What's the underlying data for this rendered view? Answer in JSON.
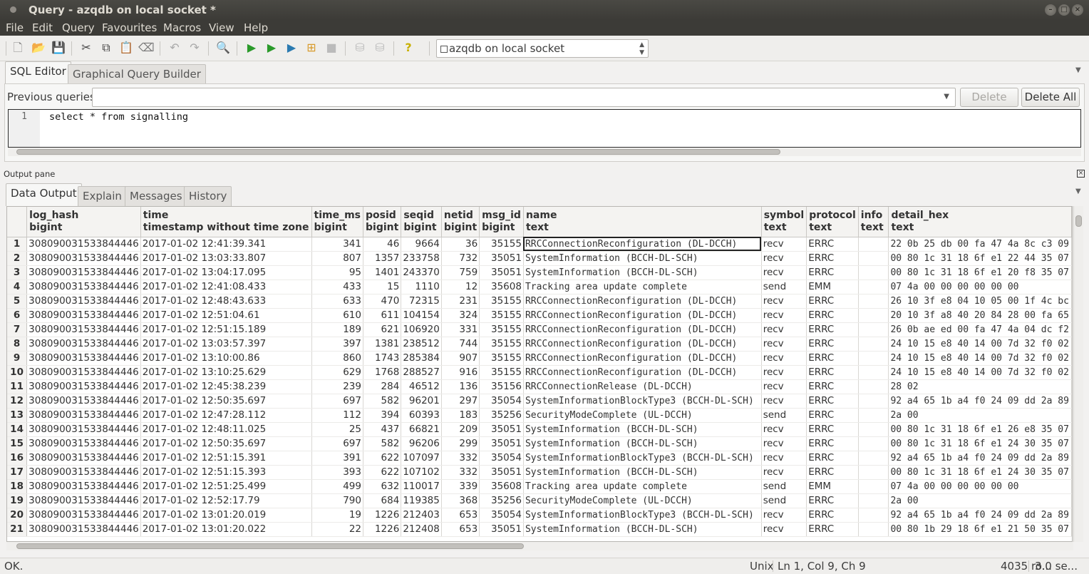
{
  "window": {
    "title": "Query - azqdb on local socket *"
  },
  "menu": [
    "File",
    "Edit",
    "Query",
    "Favourites",
    "Macros",
    "View",
    "Help"
  ],
  "toolbar": {
    "icons": [
      "new-file-icon",
      "open-folder-icon",
      "save-icon",
      "cut-icon",
      "copy-icon",
      "paste-icon",
      "clear-icon",
      "undo-icon",
      "redo-icon",
      "find-icon",
      "execute-icon",
      "execute-explain-icon",
      "execute-to-file-icon",
      "explain-icon",
      "stop-icon",
      "commit-icon",
      "rollback-icon",
      "help-icon"
    ],
    "connection": "azqdb on local socket"
  },
  "editor_tabs": [
    "SQL Editor",
    "Graphical Query Builder"
  ],
  "previous_queries": {
    "label": "Previous queries",
    "delete": "Delete",
    "delete_all": "Delete All"
  },
  "sql": {
    "line_number": "1",
    "text": "select * from signalling"
  },
  "output": {
    "pane_title": "Output pane",
    "tabs": [
      "Data Output",
      "Explain",
      "Messages",
      "History"
    ],
    "columns": [
      {
        "name": "log_hash",
        "type": "bigint"
      },
      {
        "name": "time",
        "type": "timestamp without time zone"
      },
      {
        "name": "time_ms",
        "type": "bigint"
      },
      {
        "name": "posid",
        "type": "bigint"
      },
      {
        "name": "seqid",
        "type": "bigint"
      },
      {
        "name": "netid",
        "type": "bigint"
      },
      {
        "name": "msg_id",
        "type": "bigint"
      },
      {
        "name": "name",
        "type": "text"
      },
      {
        "name": "symbol",
        "type": "text"
      },
      {
        "name": "protocol",
        "type": "text"
      },
      {
        "name": "info",
        "type": "text"
      },
      {
        "name": "detail_hex",
        "type": "text"
      }
    ],
    "rows": [
      [
        "1",
        "308090031533844446",
        "2017-01-02 12:41:39.341",
        "341",
        "46",
        "9664",
        "36",
        "35155",
        "RRCConnectionReconfiguration (DL-DCCH)",
        "recv",
        "ERRC",
        "",
        "22 0b 25 db 00 fa 47 4a 8c c3 09"
      ],
      [
        "2",
        "308090031533844446",
        "2017-01-02 13:03:33.807",
        "807",
        "1357",
        "233758",
        "732",
        "35051",
        "SystemInformation (BCCH-DL-SCH)",
        "recv",
        "ERRC",
        "",
        "00 80 1c 31 18 6f e1 22 44 35 07"
      ],
      [
        "3",
        "308090031533844446",
        "2017-01-02 13:04:17.095",
        "95",
        "1401",
        "243370",
        "759",
        "35051",
        "SystemInformation (BCCH-DL-SCH)",
        "recv",
        "ERRC",
        "",
        "00 80 1c 31 18 6f e1 20 f8 35 07"
      ],
      [
        "4",
        "308090031533844446",
        "2017-01-02 12:41:08.433",
        "433",
        "15",
        "1110",
        "12",
        "35608",
        "Tracking area update complete",
        "send",
        "EMM",
        "",
        "07 4a 00 00 00 00 00 00"
      ],
      [
        "5",
        "308090031533844446",
        "2017-01-02 12:48:43.633",
        "633",
        "470",
        "72315",
        "231",
        "35155",
        "RRCConnectionReconfiguration (DL-DCCH)",
        "recv",
        "ERRC",
        "",
        "26 10 3f e8 04 10 05 00 1f 4c bc"
      ],
      [
        "6",
        "308090031533844446",
        "2017-01-02 12:51:04.61",
        "610",
        "611",
        "104154",
        "324",
        "35155",
        "RRCConnectionReconfiguration (DL-DCCH)",
        "recv",
        "ERRC",
        "",
        "20 10 3f a8 40 20 84 28 00 fa 65"
      ],
      [
        "7",
        "308090031533844446",
        "2017-01-02 12:51:15.189",
        "189",
        "621",
        "106920",
        "331",
        "35155",
        "RRCConnectionReconfiguration (DL-DCCH)",
        "recv",
        "ERRC",
        "",
        "26 0b ae ed 00 fa 47 4a 04 dc f2"
      ],
      [
        "8",
        "308090031533844446",
        "2017-01-02 13:03:57.397",
        "397",
        "1381",
        "238512",
        "744",
        "35155",
        "RRCConnectionReconfiguration (DL-DCCH)",
        "recv",
        "ERRC",
        "",
        "24 10 15 e8 40 14 00 7d 32 f0 02"
      ],
      [
        "9",
        "308090031533844446",
        "2017-01-02 13:10:00.86",
        "860",
        "1743",
        "285384",
        "907",
        "35155",
        "RRCConnectionReconfiguration (DL-DCCH)",
        "recv",
        "ERRC",
        "",
        "24 10 15 e8 40 14 00 7d 32 f0 02"
      ],
      [
        "10",
        "308090031533844446",
        "2017-01-02 13:10:25.629",
        "629",
        "1768",
        "288527",
        "916",
        "35155",
        "RRCConnectionReconfiguration (DL-DCCH)",
        "recv",
        "ERRC",
        "",
        "24 10 15 e8 40 14 00 7d 32 f0 02"
      ],
      [
        "11",
        "308090031533844446",
        "2017-01-02 12:45:38.239",
        "239",
        "284",
        "46512",
        "136",
        "35156",
        "RRCConnectionRelease (DL-DCCH)",
        "recv",
        "ERRC",
        "",
        "28 02"
      ],
      [
        "12",
        "308090031533844446",
        "2017-01-02 12:50:35.697",
        "697",
        "582",
        "96201",
        "297",
        "35054",
        "SystemInformationBlockType3 (BCCH-DL-SCH)",
        "recv",
        "ERRC",
        "",
        "92 a4 65 1b a4 f0 24 09 dd 2a 89"
      ],
      [
        "13",
        "308090031533844446",
        "2017-01-02 12:47:28.112",
        "112",
        "394",
        "60393",
        "183",
        "35256",
        "SecurityModeComplete (UL-DCCH)",
        "send",
        "ERRC",
        "",
        "2a 00"
      ],
      [
        "14",
        "308090031533844446",
        "2017-01-02 12:48:11.025",
        "25",
        "437",
        "66821",
        "209",
        "35051",
        "SystemInformation (BCCH-DL-SCH)",
        "recv",
        "ERRC",
        "",
        "00 80 1c 31 18 6f e1 26 e8 35 07"
      ],
      [
        "15",
        "308090031533844446",
        "2017-01-02 12:50:35.697",
        "697",
        "582",
        "96206",
        "299",
        "35051",
        "SystemInformation (BCCH-DL-SCH)",
        "recv",
        "ERRC",
        "",
        "00 80 1c 31 18 6f e1 24 30 35 07"
      ],
      [
        "16",
        "308090031533844446",
        "2017-01-02 12:51:15.391",
        "391",
        "622",
        "107097",
        "332",
        "35054",
        "SystemInformationBlockType3 (BCCH-DL-SCH)",
        "recv",
        "ERRC",
        "",
        "92 a4 65 1b a4 f0 24 09 dd 2a 89"
      ],
      [
        "17",
        "308090031533844446",
        "2017-01-02 12:51:15.393",
        "393",
        "622",
        "107102",
        "332",
        "35051",
        "SystemInformation (BCCH-DL-SCH)",
        "recv",
        "ERRC",
        "",
        "00 80 1c 31 18 6f e1 24 30 35 07"
      ],
      [
        "18",
        "308090031533844446",
        "2017-01-02 12:51:25.499",
        "499",
        "632",
        "110017",
        "339",
        "35608",
        "Tracking area update complete",
        "send",
        "EMM",
        "",
        "07 4a 00 00 00 00 00 00"
      ],
      [
        "19",
        "308090031533844446",
        "2017-01-02 12:52:17.79",
        "790",
        "684",
        "119385",
        "368",
        "35256",
        "SecurityModeComplete (UL-DCCH)",
        "send",
        "ERRC",
        "",
        "2a 00"
      ],
      [
        "20",
        "308090031533844446",
        "2017-01-02 13:01:20.019",
        "19",
        "1226",
        "212403",
        "653",
        "35054",
        "SystemInformationBlockType3 (BCCH-DL-SCH)",
        "recv",
        "ERRC",
        "",
        "92 a4 65 1b a4 f0 24 09 dd 2a 89"
      ],
      [
        "21",
        "308090031533844446",
        "2017-01-02 13:01:20.022",
        "22",
        "1226",
        "212408",
        "653",
        "35051",
        "SystemInformation (BCCH-DL-SCH)",
        "recv",
        "ERRC",
        "",
        "00 80 1b 29 18 6f e1 21 50 35 07"
      ]
    ]
  },
  "status": {
    "message": "OK.",
    "line_ending": "Unix",
    "cursor": "Ln 1, Col 9, Ch 9",
    "rows": "4035 ro...",
    "time": "3.0 se..."
  }
}
